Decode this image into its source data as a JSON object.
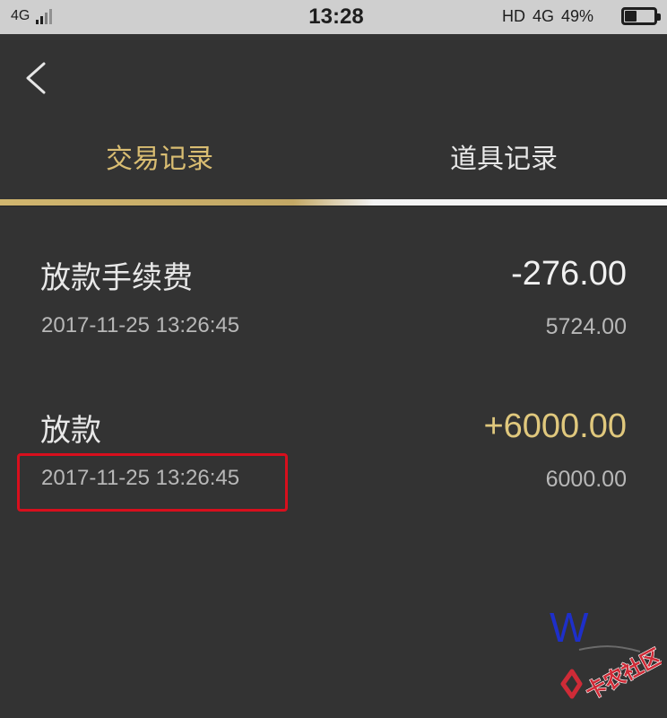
{
  "status_bar": {
    "network": "4G",
    "time": "13:28",
    "right_hd": "HD",
    "right_network": "4G",
    "battery": "49%"
  },
  "header": {
    "back_icon": "back-chevron-icon"
  },
  "tabs": [
    {
      "label": "交易记录",
      "active": true
    },
    {
      "label": "道具记录",
      "active": false
    }
  ],
  "transactions": [
    {
      "title": "放款手续费",
      "amount": "-276.00",
      "time": "2017-11-25 13:26:45",
      "balance": "5724.00"
    },
    {
      "title": "放款",
      "amount": "+6000.00",
      "time": "2017-11-25 13:26:45",
      "balance": "6000.00"
    }
  ],
  "annotations": {
    "handwritten_mark": "W",
    "watermark_text": "卡农社区"
  },
  "colors": {
    "background": "#333333",
    "active_tab": "#d9bd72",
    "positive_amount": "#e0c87d",
    "highlight": "#d80f1d",
    "annotation": "#1e2fc9"
  }
}
